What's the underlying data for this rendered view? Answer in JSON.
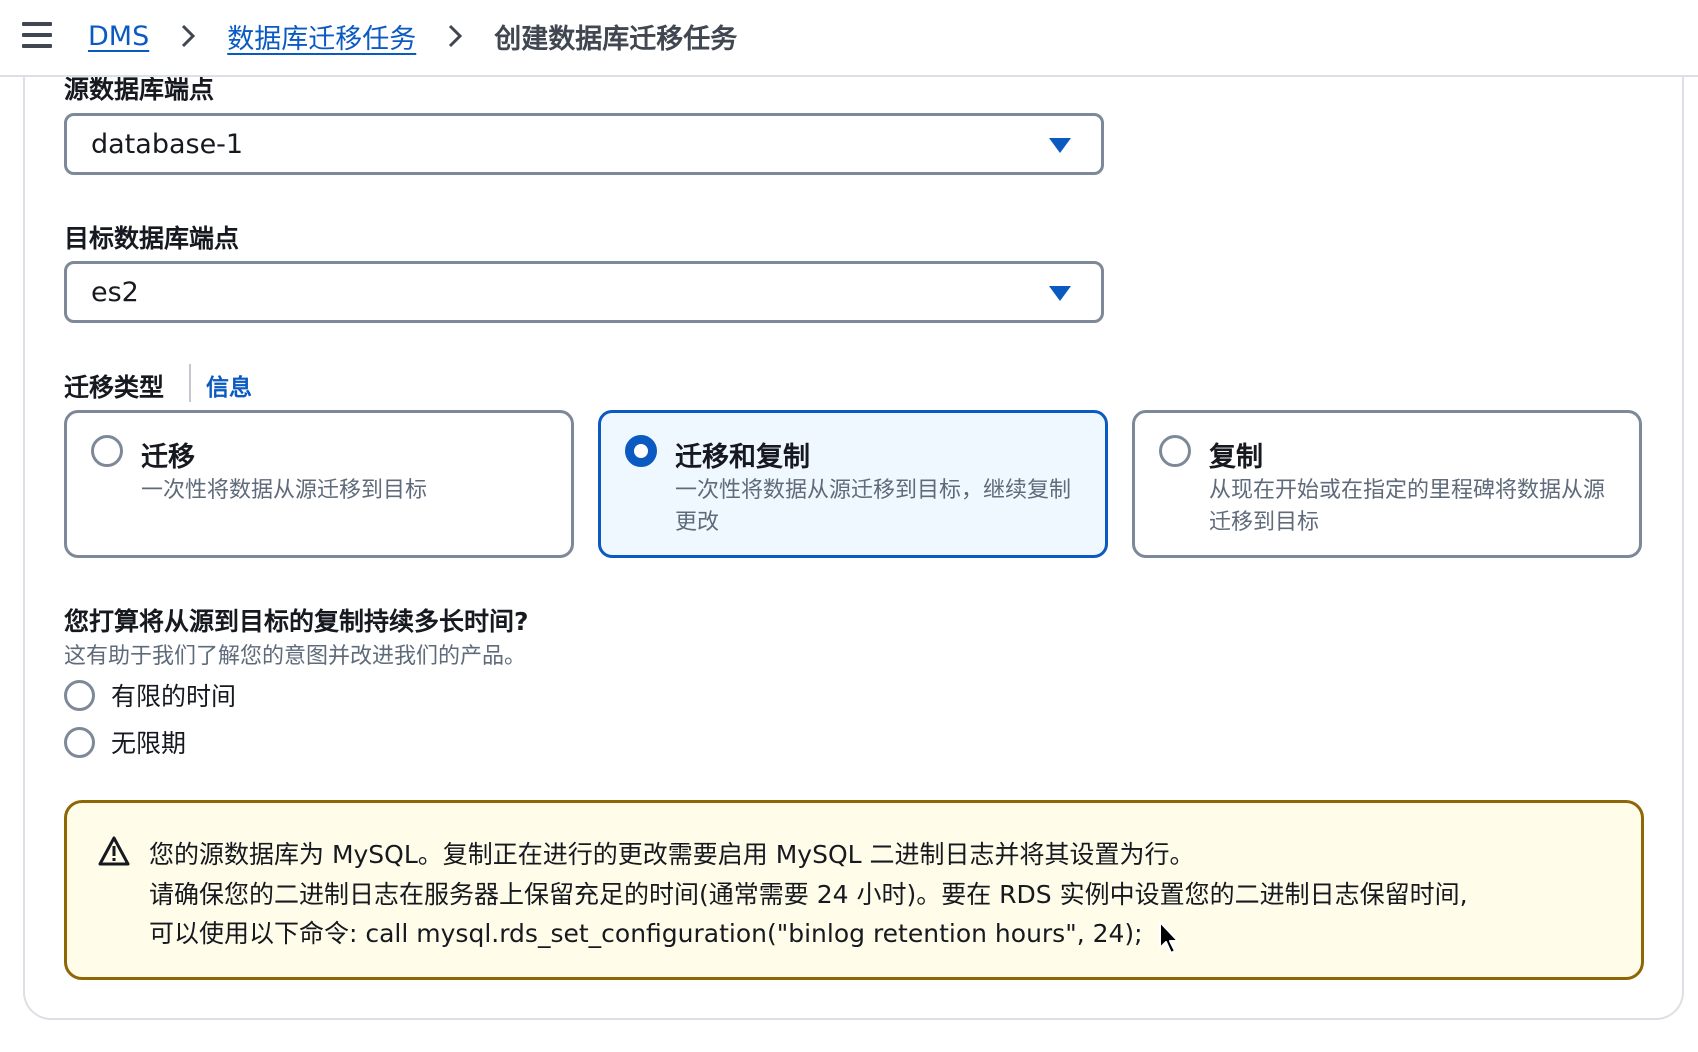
{
  "breadcrumb": {
    "items": [
      {
        "label": "DMS"
      },
      {
        "label": "数据库迁移任务"
      }
    ],
    "current": "创建数据库迁移任务"
  },
  "source_endpoint": {
    "label": "源数据库端点",
    "value": "database-1"
  },
  "target_endpoint": {
    "label": "目标数据库端点",
    "value": "es2"
  },
  "migration_type": {
    "label": "迁移类型",
    "info_link": "信息",
    "options": [
      {
        "title": "迁移",
        "description": "一次性将数据从源迁移到目标",
        "selected": false
      },
      {
        "title": "迁移和复制",
        "description": "一次性将数据从源迁移到目标，继续复制更改",
        "selected": true
      },
      {
        "title": "复制",
        "description": "从现在开始或在指定的里程碑将数据从源迁移到目标",
        "selected": false
      }
    ]
  },
  "duration": {
    "question": "您打算将从源到目标的复制持续多长时间?",
    "subtext": "这有助于我们了解您的意图并改进我们的产品。",
    "options": [
      {
        "label": "有限的时间",
        "selected": false
      },
      {
        "label": "无限期",
        "selected": false
      }
    ]
  },
  "alert": {
    "icon": "warning-icon",
    "lines": [
      "您的源数据库为 MySQL。复制正在进行的更改需要启用 MySQL 二进制日志并将其设置为行。",
      "请确保您的二进制日志在服务器上保留充足的时间(通常需要 24 小时)。要在 RDS 实例中设置您的二进制日志保留时间,",
      "可以使用以下命令: call mysql.rds_set_configuration(\"binlog retention hours\", 24);"
    ]
  },
  "colors": {
    "link": "#0a5ac2",
    "selected_bg": "#f0f8ff",
    "warning_border": "#8d6605",
    "warning_bg": "#fffce9"
  }
}
